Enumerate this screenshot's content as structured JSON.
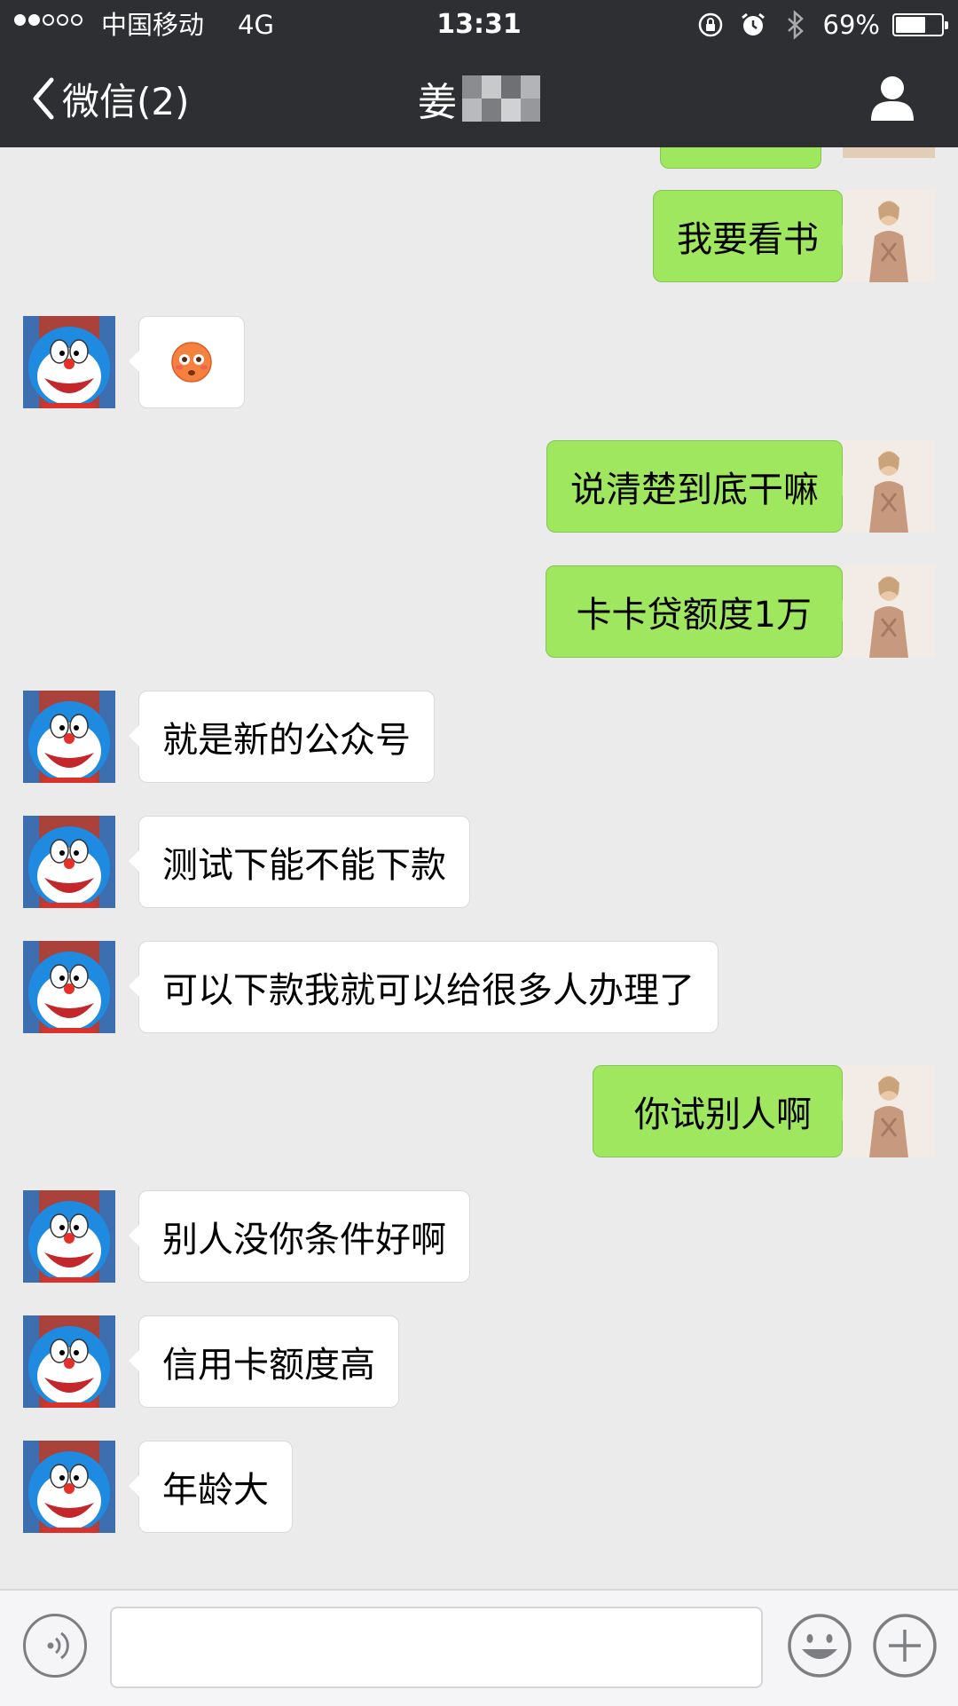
{
  "status_bar": {
    "carrier": "中国移动",
    "network": "4G",
    "time": "13:31",
    "battery": "69%",
    "battery_level": 0.69,
    "signal_strength": 2,
    "signal_max": 5,
    "icons": [
      "orientation-lock-icon",
      "alarm-icon",
      "bluetooth-icon"
    ]
  },
  "nav": {
    "back_label": "微信(2)",
    "title": "姜",
    "profile_icon": "person-icon"
  },
  "colors": {
    "nav_bg": "#2d2f33",
    "chat_bg": "#ebebeb",
    "outgoing_bubble": "#9ee75f",
    "incoming_bubble": "#ffffff"
  },
  "messages": [
    {
      "sender": "me",
      "text": "我要看书"
    },
    {
      "sender": "them",
      "emoji": "flushed-face-emoji"
    },
    {
      "sender": "me",
      "text": "说清楚到底干嘛"
    },
    {
      "sender": "me",
      "text": "卡卡贷额度1万"
    },
    {
      "sender": "them",
      "text": "就是新的公众号"
    },
    {
      "sender": "them",
      "text": "测试下能不能下款"
    },
    {
      "sender": "them",
      "text": "可以下款我就可以给很多人办理了"
    },
    {
      "sender": "me",
      "text": "你试别人啊"
    },
    {
      "sender": "them",
      "text": "别人没你条件好啊"
    },
    {
      "sender": "them",
      "text": "信用卡额度高"
    },
    {
      "sender": "them",
      "text": "年龄大"
    }
  ],
  "input_bar": {
    "voice_icon": "voice-icon",
    "text_value": "",
    "emoji_icon": "smiley-icon",
    "plus_icon": "plus-icon"
  }
}
